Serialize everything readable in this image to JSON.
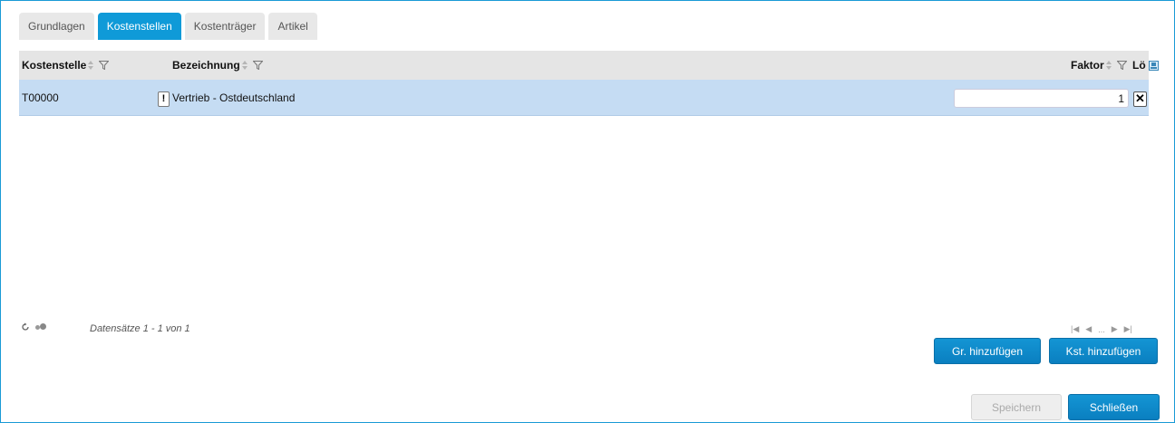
{
  "tabs": [
    {
      "label": "Grundlagen",
      "active": false
    },
    {
      "label": "Kostenstellen",
      "active": true
    },
    {
      "label": "Kostenträger",
      "active": false
    },
    {
      "label": "Artikel",
      "active": false
    }
  ],
  "grid": {
    "columns": {
      "kostenstelle": "Kostenstelle",
      "bezeichnung": "Bezeichnung",
      "faktor": "Faktor",
      "loeschen": "Lö"
    },
    "rows": [
      {
        "kostenstelle": "T00000",
        "warning": "!",
        "bezeichnung": "Vertrieb - Ostdeutschland",
        "faktor": "1",
        "delete": "✕"
      }
    ]
  },
  "footer": {
    "records": "Datensätze 1 - 1 von 1",
    "pager_ellipsis": "..."
  },
  "buttons": {
    "add_group": "Gr. hinzufügen",
    "add_cost_center": "Kst. hinzufügen",
    "save": "Speichern",
    "close": "Schließen"
  },
  "colors": {
    "accent": "#0f9ad8",
    "row_selected": "#c5dcf3",
    "header_bg": "#e5e5e5"
  }
}
